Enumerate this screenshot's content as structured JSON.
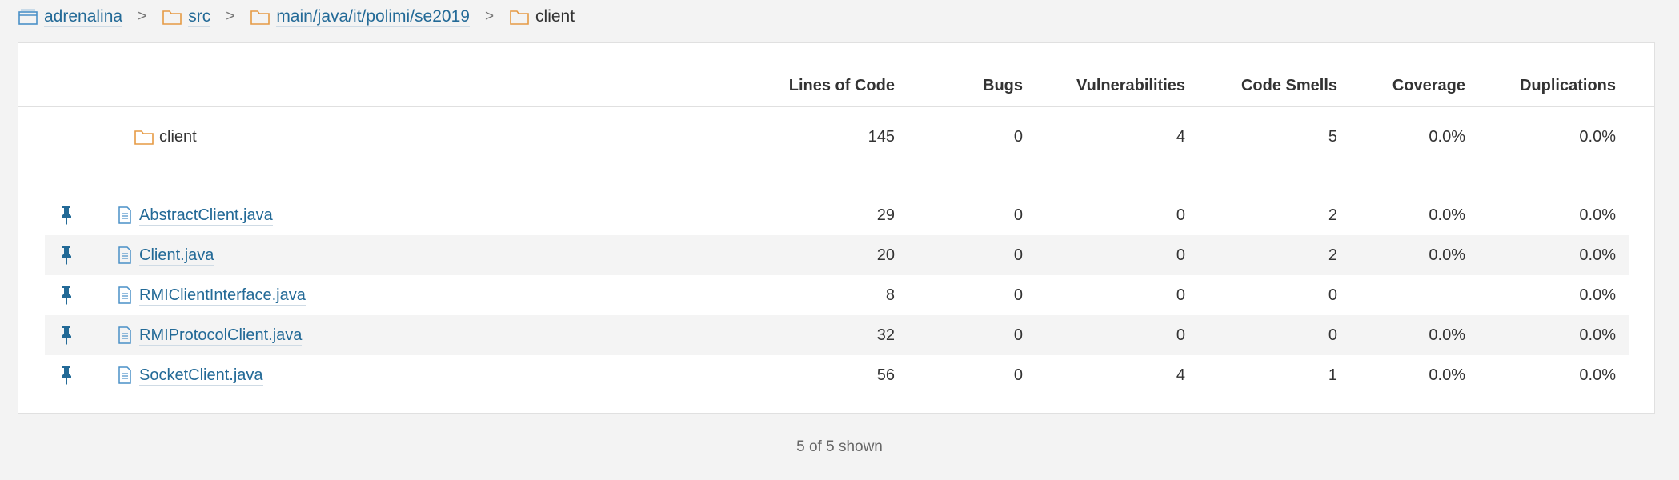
{
  "breadcrumb": [
    {
      "label": "adrenalina",
      "icon": "project-icon"
    },
    {
      "label": "src",
      "icon": "folder-icon"
    },
    {
      "label": "main/java/it/polimi/se2019",
      "icon": "folder-icon"
    },
    {
      "label": "client",
      "icon": "folder-icon"
    }
  ],
  "breadcrumb_separator": ">",
  "columns": [
    "Lines of Code",
    "Bugs",
    "Vulnerabilities",
    "Code Smells",
    "Coverage",
    "Duplications"
  ],
  "base_row": {
    "name": "client",
    "loc": "145",
    "bugs": "0",
    "vulns": "4",
    "smells": "5",
    "coverage": "0.0%",
    "dup": "0.0%"
  },
  "files": [
    {
      "name": "AbstractClient.java",
      "loc": "29",
      "bugs": "0",
      "vulns": "0",
      "smells": "2",
      "coverage": "0.0%",
      "dup": "0.0%"
    },
    {
      "name": "Client.java",
      "loc": "20",
      "bugs": "0",
      "vulns": "0",
      "smells": "2",
      "coverage": "0.0%",
      "dup": "0.0%"
    },
    {
      "name": "RMIClientInterface.java",
      "loc": "8",
      "bugs": "0",
      "vulns": "0",
      "smells": "0",
      "coverage": "",
      "dup": "0.0%"
    },
    {
      "name": "RMIProtocolClient.java",
      "loc": "32",
      "bugs": "0",
      "vulns": "0",
      "smells": "0",
      "coverage": "0.0%",
      "dup": "0.0%"
    },
    {
      "name": "SocketClient.java",
      "loc": "56",
      "bugs": "0",
      "vulns": "4",
      "smells": "1",
      "coverage": "0.0%",
      "dup": "0.0%"
    }
  ],
  "footer": "5 of 5 shown",
  "colors": {
    "link": "#236a97",
    "folder": "#e69a44",
    "file": "#4a90c7",
    "pin": "#236a97"
  }
}
